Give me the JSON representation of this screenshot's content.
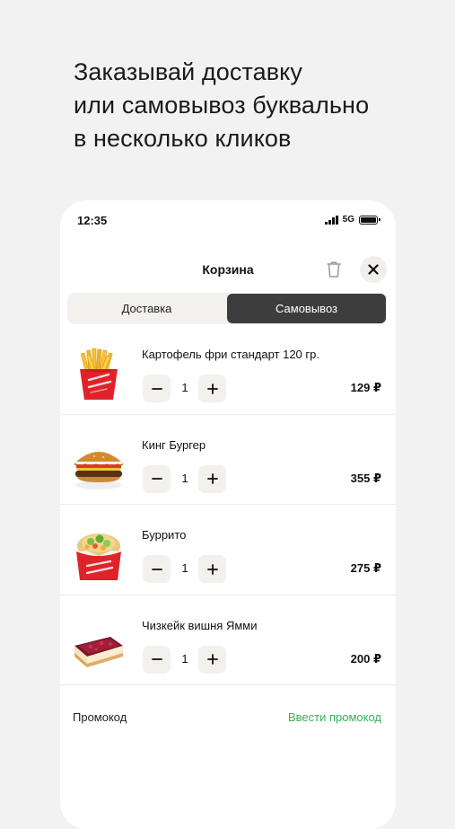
{
  "headline": {
    "line1": "Заказывай доставку",
    "line2": "или самовывоз буквально",
    "line3": "в несколько кликов"
  },
  "status_bar": {
    "time": "12:35",
    "network": "5G"
  },
  "cart": {
    "title": "Корзина",
    "tabs": [
      {
        "label": "Доставка",
        "active": false
      },
      {
        "label": "Самовывоз",
        "active": true
      }
    ],
    "items": [
      {
        "name": "Картофель фри стандарт 120 гр.",
        "quantity": "1",
        "price": "129 ₽",
        "image": "fries"
      },
      {
        "name": "Кинг Бургер",
        "quantity": "1",
        "price": "355 ₽",
        "image": "burger"
      },
      {
        "name": "Буррито",
        "quantity": "1",
        "price": "275 ₽",
        "image": "burrito"
      },
      {
        "name": "Чизкейк вишня Ямми",
        "quantity": "1",
        "price": "200 ₽",
        "image": "cheesecake"
      }
    ],
    "promo": {
      "label": "Промокод",
      "action": "Ввести промокод",
      "action_color": "#2fb45a"
    },
    "tab_active_color": "#3d3d3d",
    "package_red": "#e0232a"
  },
  "icons": {
    "trash": "trash-icon",
    "close": "close-icon",
    "minus": "minus-icon",
    "plus": "plus-icon",
    "signal": "signal-icon",
    "battery": "battery-icon"
  }
}
